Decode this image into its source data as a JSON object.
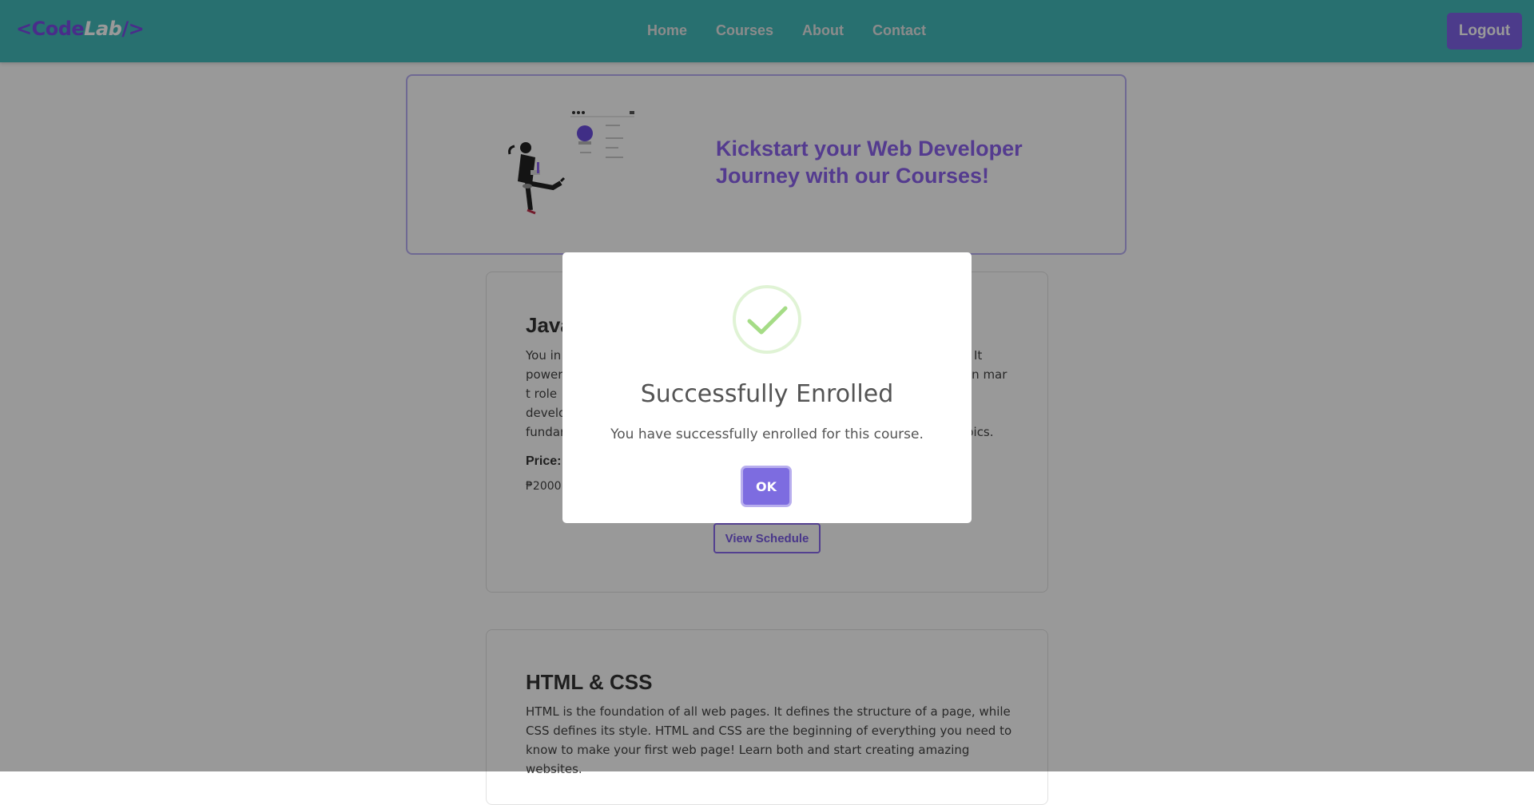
{
  "nav": {
    "brand_open": "<Code",
    "brand_lab": "Lab",
    "brand_close": "/>",
    "links": [
      "Home",
      "Courses",
      "About",
      "Contact"
    ],
    "logout": "Logout"
  },
  "hero": {
    "title": "Kickstart your Web Developer Journey with our Courses!"
  },
  "courses": [
    {
      "title": "Java",
      "description_visible_fragments": [
        "You in",
        "It",
        "power",
        "t role",
        "in mar",
        "develo",
        "fundar",
        "pics."
      ],
      "price_label": "Price:",
      "price_value": "₱2000",
      "button": "View Schedule"
    },
    {
      "title": "HTML & CSS",
      "description": "HTML is the foundation of all web pages. It defines the structure of a page, while CSS defines its style. HTML and CSS are the beginning of everything you need to know to make your first web page! Learn both and start creating amazing websites."
    }
  ],
  "modal": {
    "icon": "success-check-icon",
    "title": "Successfully Enrolled",
    "text": "You have successfully enrolled for this course.",
    "ok": "OK"
  },
  "colors": {
    "navbar": "#43bbbb",
    "accent": "#7f63e8",
    "success": "#a5dc86"
  }
}
